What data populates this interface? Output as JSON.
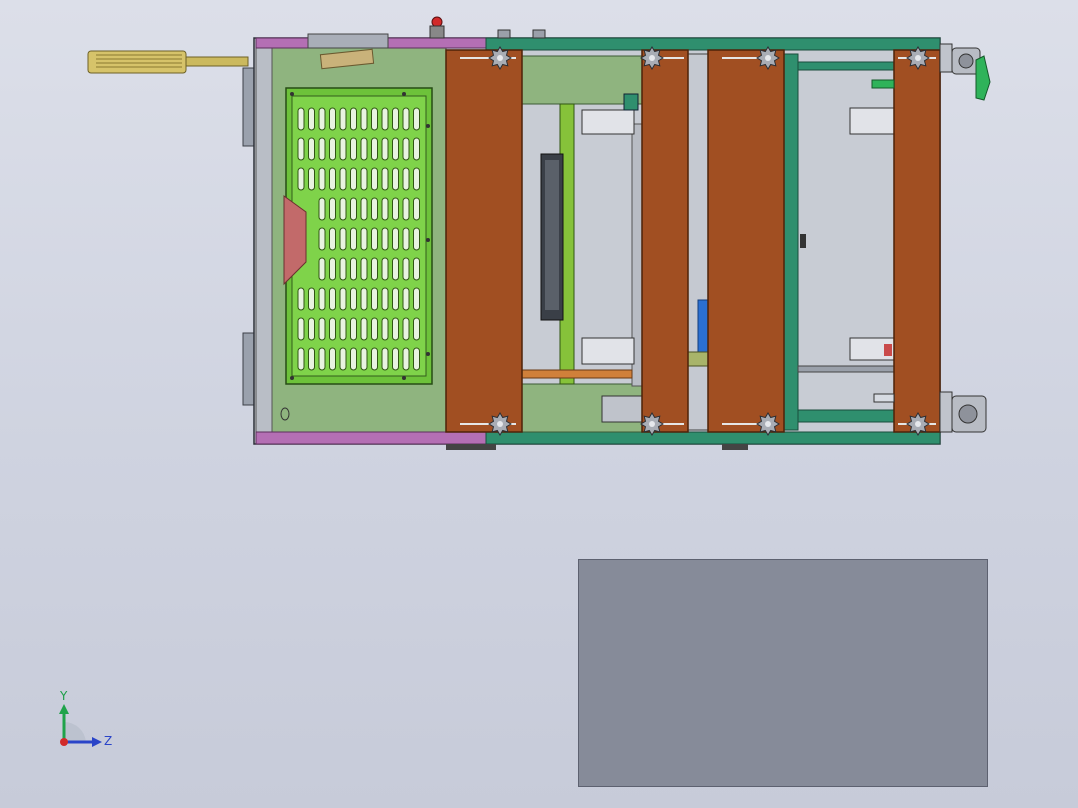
{
  "triad": {
    "y_label": "Y",
    "z_label": "Z"
  },
  "colors": {
    "background": "#d3d6e2",
    "frame_green": "#2f8f6e",
    "brown_plate": "#a14f22",
    "perforated_plate": "#7fd34a",
    "base_plate": "#8fb47f",
    "magenta_rail": "#b46fb4",
    "handle_gold": "#d6c36a",
    "overlay_panel": "#868b99"
  },
  "icons": [
    "coordinate-triad-icon"
  ]
}
